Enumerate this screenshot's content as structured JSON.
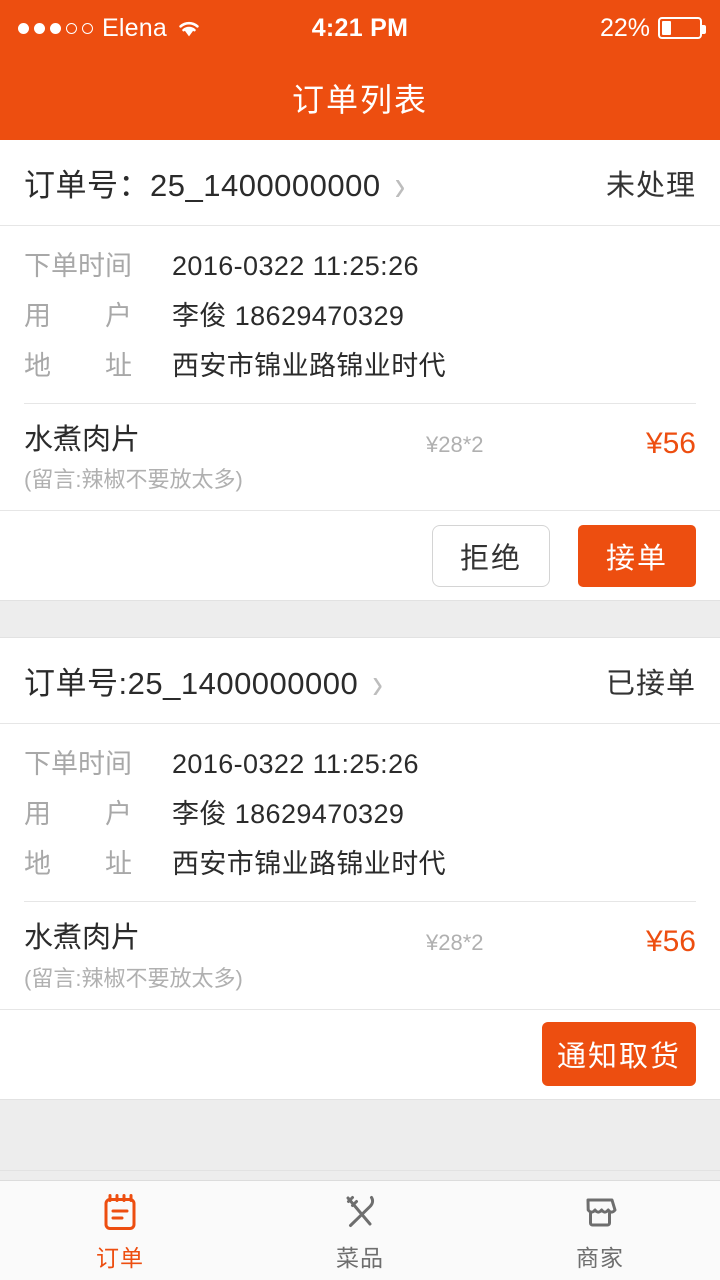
{
  "status_bar": {
    "signal_dots_filled": 3,
    "signal_dots_total": 5,
    "carrier": "Elena",
    "wifi_icon": "wifi-icon",
    "time": "4:21 PM",
    "battery_percent": "22%",
    "battery_level": 22
  },
  "navbar": {
    "title": "订单列表",
    "background": "#ED4E10"
  },
  "colors": {
    "accent": "#ED4E10",
    "text_primary": "#2b2b2b",
    "text_muted": "#a8a8a8",
    "divider": "#e6e6e6",
    "gap_band": "#ededed"
  },
  "orders": [
    {
      "order_label": "订单号：",
      "order_number": "25_1400000000",
      "chevron_icon": "chevron-right-icon",
      "status": "未处理",
      "meta": [
        {
          "label": "下单时间",
          "label_chars": [
            "下",
            "单",
            "时",
            "间"
          ],
          "value": "2016-0322   11:25:26"
        },
        {
          "label": "用　　户",
          "label_chars": [
            "用",
            "户"
          ],
          "value": "李俊   18629470329"
        },
        {
          "label": "地　　址",
          "label_chars": [
            "地",
            "址"
          ],
          "value": "西安市锦业路锦业时代"
        }
      ],
      "items": [
        {
          "name": "水煮肉片",
          "note": "(留言:辣椒不要放太多)",
          "unit_price": "¥28*2",
          "total": "¥56"
        }
      ],
      "actions": [
        {
          "label": "拒绝",
          "style": "ghost",
          "name": "reject-button"
        },
        {
          "label": "接单",
          "style": "primary",
          "name": "accept-button"
        }
      ]
    },
    {
      "order_label": "订单号:",
      "order_number": "25_1400000000",
      "chevron_icon": "chevron-right-icon",
      "status": "已接单",
      "meta": [
        {
          "label": "下单时间",
          "label_chars": [
            "下",
            "单",
            "时",
            "间"
          ],
          "value": "2016-0322   11:25:26"
        },
        {
          "label": "用　　户",
          "label_chars": [
            "用",
            "户"
          ],
          "value": "李俊   18629470329"
        },
        {
          "label": "地　　址",
          "label_chars": [
            "地",
            "址"
          ],
          "value": "西安市锦业路锦业时代"
        }
      ],
      "items": [
        {
          "name": "水煮肉片",
          "note": "(留言:辣椒不要放太多)",
          "unit_price": "¥28*2",
          "total": "¥56"
        }
      ],
      "actions": [
        {
          "label": "通知取货",
          "style": "primary-wide",
          "name": "notify-pickup-button"
        }
      ]
    }
  ],
  "tabbar": {
    "items": [
      {
        "label": "订单",
        "icon": "notepad-icon",
        "active": true
      },
      {
        "label": "菜品",
        "icon": "cutlery-icon",
        "active": false
      },
      {
        "label": "商家",
        "icon": "shop-icon",
        "active": false
      }
    ]
  }
}
